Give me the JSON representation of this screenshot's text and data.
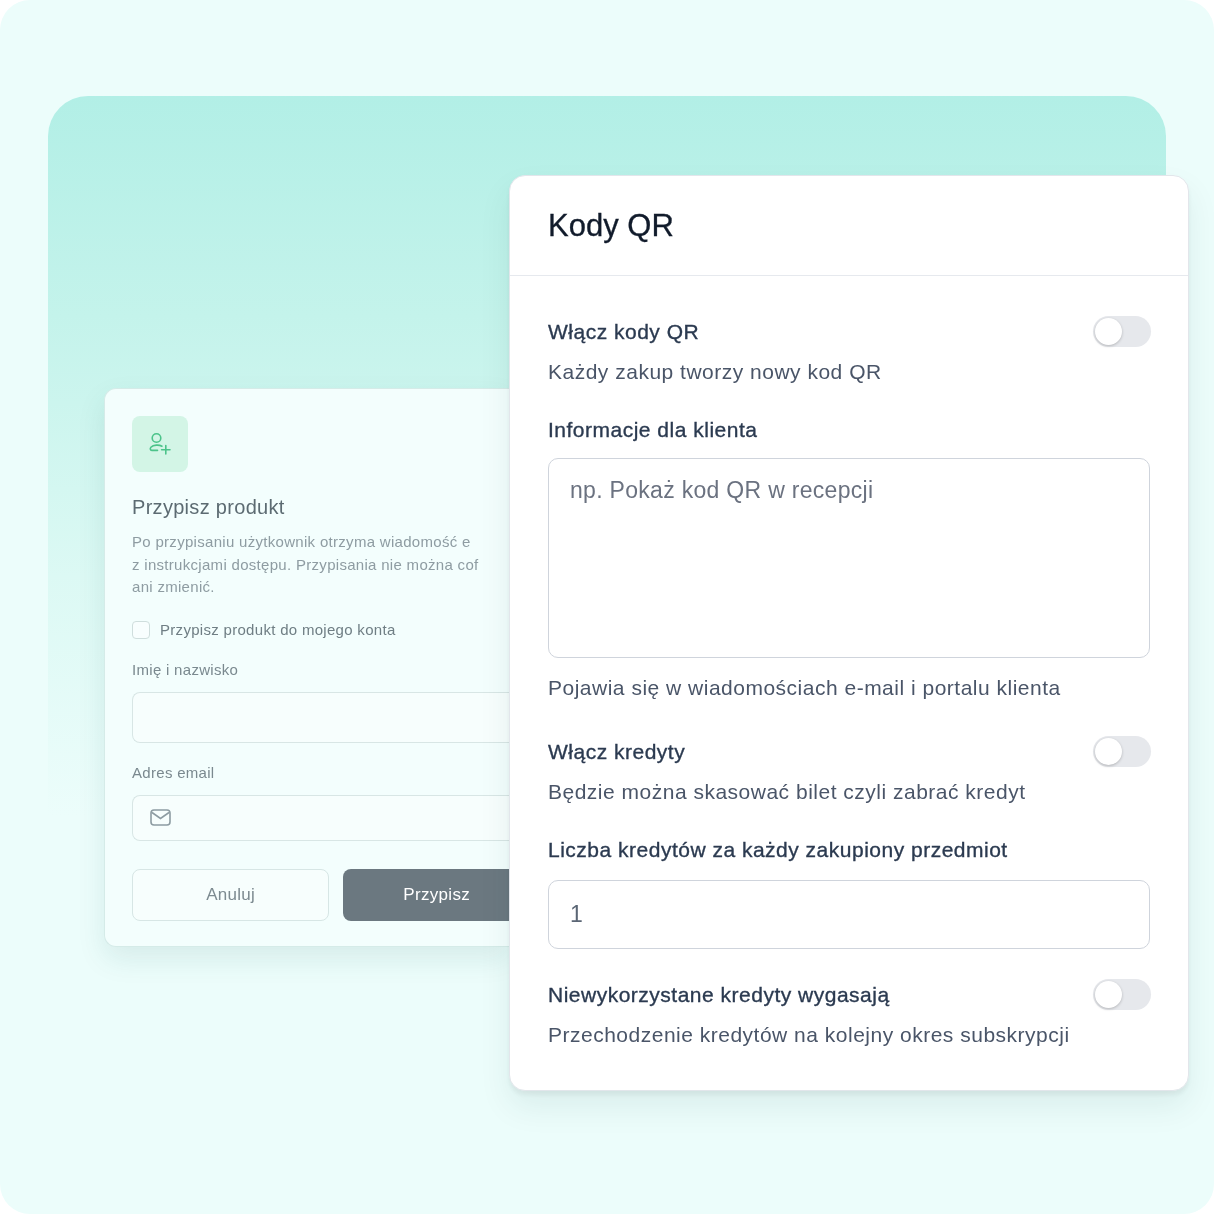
{
  "assign_dialog": {
    "title": "Przypisz produkt",
    "description": "Po przypisaniu użytkownik otrzyma wiadomość e\nz instrukcjami dostępu. Przypisania nie można cof\nani zmienić.",
    "checkbox": {
      "label": "Przypisz produkt do mojego konta",
      "checked": false
    },
    "fields": [
      {
        "kind": "text",
        "label": "Imię i nazwisko"
      },
      {
        "kind": "email",
        "label": "Adres email"
      }
    ],
    "buttons": [
      {
        "kind": "cancel",
        "label": "Anuluj"
      },
      {
        "kind": "submit",
        "label": "Przypisz"
      }
    ]
  },
  "qr_settings": {
    "title": "Kody QR",
    "settings": [
      {
        "kind": "toggle",
        "label": "Włącz kody QR",
        "description": "Każdy zakup tworzy nowy kod QR",
        "on": false
      },
      {
        "kind": "textarea",
        "label": "Informacje dla klienta",
        "placeholder": "np. Pokaż kod QR w recepcji",
        "help": "Pojawia się w wiadomościach e-mail i portalu klienta"
      },
      {
        "kind": "toggle",
        "label": "Włącz kredyty",
        "description": "Będzie można skasować bilet czyli zabrać kredyt",
        "on": false
      },
      {
        "kind": "number",
        "label": "Liczba kredytów za każdy zakupiony przedmiot",
        "value": "1"
      },
      {
        "kind": "toggle",
        "label": "Niewykorzystane kredyty wygasają",
        "description": "Przechodzenie kredytów na kolejny okres subskrypcji",
        "on": false
      }
    ]
  }
}
